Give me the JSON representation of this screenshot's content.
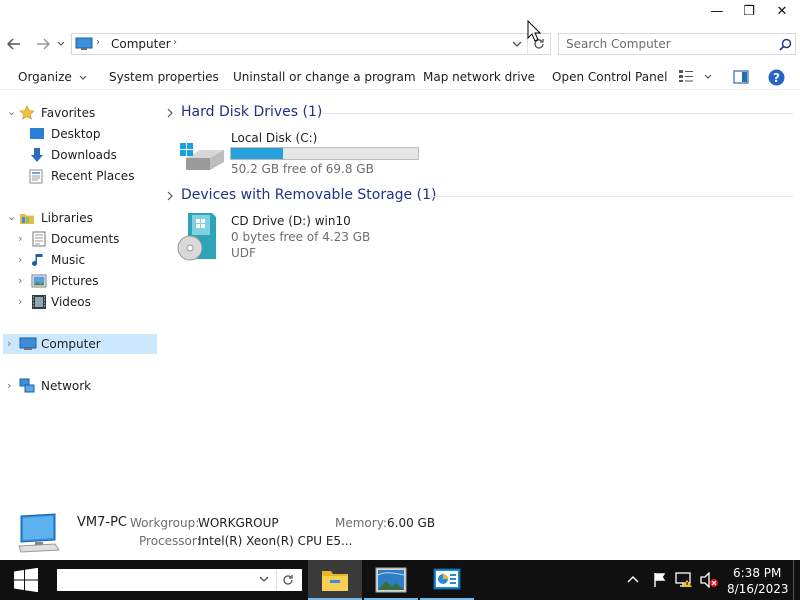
{
  "titlebar": {
    "minimize_glyph": "—",
    "restore_glyph": "❐",
    "close_glyph": "✕"
  },
  "address": {
    "breadcrumb": [
      "Computer"
    ],
    "search_placeholder": "Search Computer"
  },
  "toolbar": {
    "organize": "Organize",
    "system_properties": "System properties",
    "uninstall": "Uninstall or change a program",
    "map_network": "Map network drive",
    "open_control_panel": "Open Control Panel"
  },
  "nav": {
    "favorites": "Favorites",
    "desktop": "Desktop",
    "downloads": "Downloads",
    "recent_places": "Recent Places",
    "libraries": "Libraries",
    "documents": "Documents",
    "music": "Music",
    "pictures": "Pictures",
    "videos": "Videos",
    "computer": "Computer",
    "network": "Network"
  },
  "content": {
    "hdd_group": "Hard Disk Drives (1)",
    "local_disk": {
      "name": "Local Disk (C:)",
      "free": "50.2 GB free of 69.8 GB",
      "used_fraction": 0.28
    },
    "removable_group": "Devices with Removable Storage (1)",
    "cd_drive": {
      "name": "CD Drive (D:) win10",
      "free": "0 bytes free of 4.23 GB",
      "fs": "UDF"
    }
  },
  "details": {
    "pc_name": "VM7-PC",
    "workgroup_label": "Workgroup:",
    "workgroup": "WORKGROUP",
    "memory_label": "Memory:",
    "memory": "6.00 GB",
    "processor_label": "Processor:",
    "processor": "Intel(R) Xeon(R) CPU E5..."
  },
  "taskbar": {
    "time": "6:38 PM",
    "date": "8/16/2023"
  },
  "colors": {
    "accent": "#1e3287",
    "selection": "#cce8ff",
    "progress": "#26a0da",
    "taskbar": "#101010"
  }
}
